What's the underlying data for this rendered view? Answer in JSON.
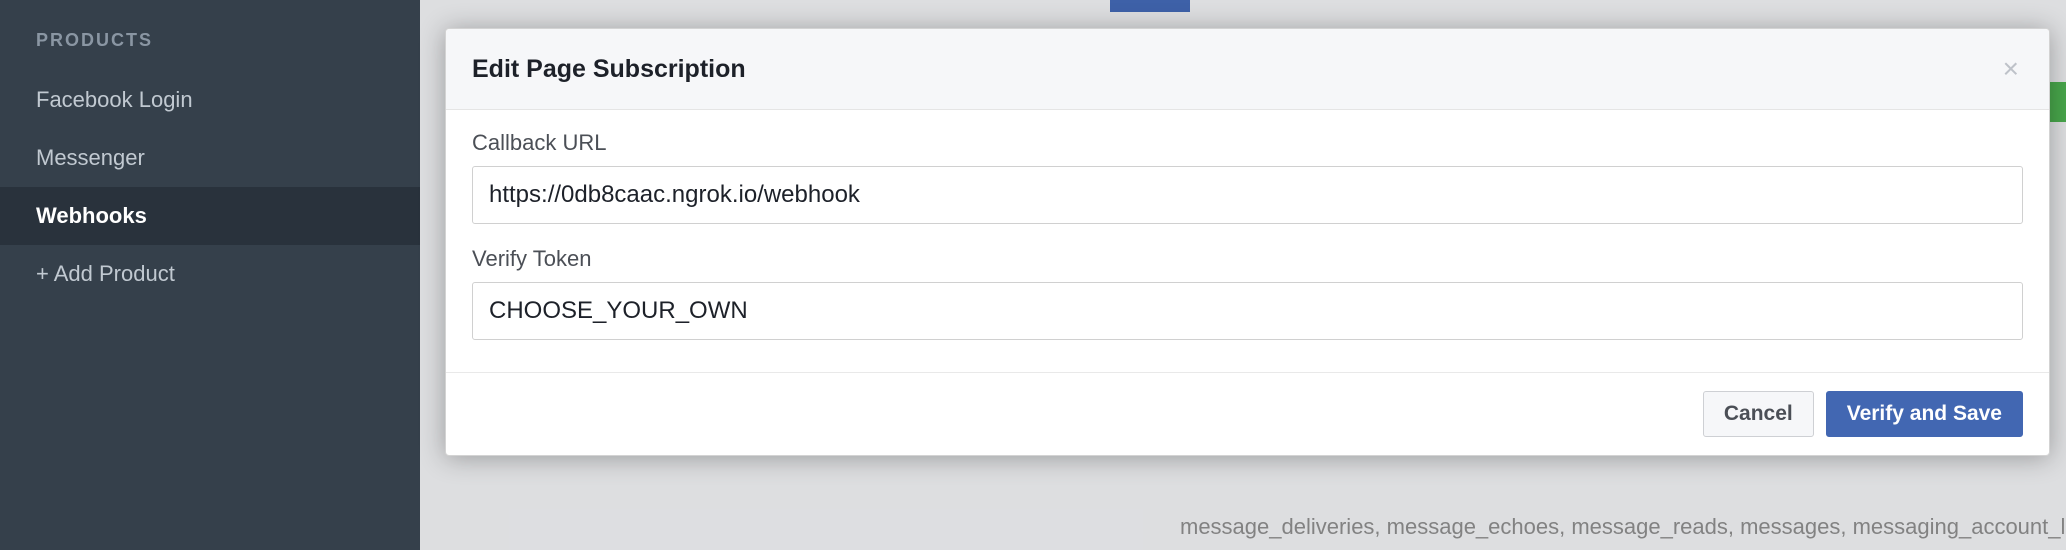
{
  "sidebar": {
    "header": "PRODUCTS",
    "items": [
      {
        "label": "Facebook Login",
        "active": false
      },
      {
        "label": "Messenger",
        "active": false
      },
      {
        "label": "Webhooks",
        "active": true
      },
      {
        "label": "+ Add Product",
        "active": false
      }
    ]
  },
  "modal": {
    "title": "Edit Page Subscription",
    "close_label": "×",
    "fields": {
      "callback_url": {
        "label": "Callback URL",
        "value": "https://0db8caac.ngrok.io/webhook"
      },
      "verify_token": {
        "label": "Verify Token",
        "value": "CHOOSE_YOUR_OWN"
      }
    },
    "buttons": {
      "cancel": "Cancel",
      "verify_save": "Verify and Save"
    }
  },
  "background_text": "message_deliveries, message_echoes, message_reads, messages, messaging_account_linking,"
}
